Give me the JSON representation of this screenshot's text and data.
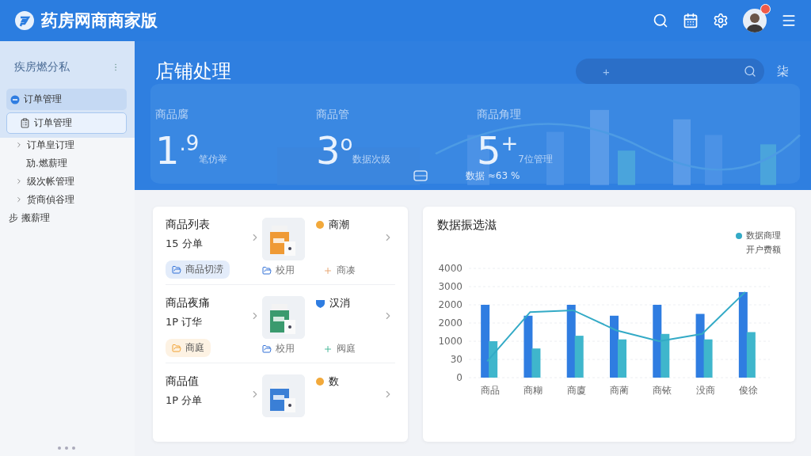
{
  "header": {
    "title": "药房网商商家版",
    "badge": true
  },
  "sidebar": {
    "title": "疾房燃分私",
    "items": [
      {
        "label": "订单管理",
        "kind": "group",
        "expanded": true,
        "selected": false,
        "children": [
          {
            "label": "订单管理",
            "kind": "page",
            "selected": true
          }
        ]
      },
      {
        "label": "订单皇订理",
        "kind": "folder",
        "expanded": false,
        "selected": false
      },
      {
        "label": "劢.燃薪理",
        "kind": "leaf",
        "selected": false
      },
      {
        "label": "级次帐管理",
        "kind": "folder",
        "expanded": false,
        "selected": false
      },
      {
        "label": "货商偵谷理",
        "kind": "folder",
        "expanded": false,
        "selected": false
      },
      {
        "label": "步 搬薪理",
        "kind": "root",
        "selected": false
      }
    ]
  },
  "hero": {
    "title": "店铺处理",
    "search_placeholder": "+",
    "side_label": "柒",
    "stats": [
      {
        "label": "商品腐",
        "value": "1",
        "sup": ".9",
        "unit": "笔仿举"
      },
      {
        "label": "商品管",
        "value": "3",
        "sup": "o",
        "unit": "数据次级"
      },
      {
        "label": "商品角理",
        "value": "5",
        "sup": "+",
        "unit": "7位管理"
      }
    ],
    "footer": "数据 ≈63 %"
  },
  "products": [
    {
      "name": "商品列表",
      "count": "15 分单",
      "tag": "商品切涝",
      "title": "商潮",
      "kind": "dot",
      "color": "#f2a93b",
      "note1": "校用",
      "note2": "商凑"
    },
    {
      "name": "商品夜痛",
      "count": "1P 订华",
      "tag": "商庭",
      "title": "汉消",
      "kind": "shield",
      "color": "#2f7de1",
      "note1": "校用",
      "note2": "阀庭"
    },
    {
      "name": "商品值",
      "count": "1P 分单",
      "title": "数",
      "kind": "dot",
      "color": "#f2a93b"
    }
  ],
  "chart": {
    "title": "数据振选滋",
    "legend": "数据商理",
    "legend_note": "开户费额",
    "y_axis_labels": [
      "4000",
      "3000",
      "2000",
      "2000",
      "1000",
      "30",
      "0"
    ],
    "x_axis_labels": [
      "商品",
      "商糊",
      "商廈",
      "商蔺",
      "商铱",
      "没商",
      "俊徐"
    ]
  }
}
